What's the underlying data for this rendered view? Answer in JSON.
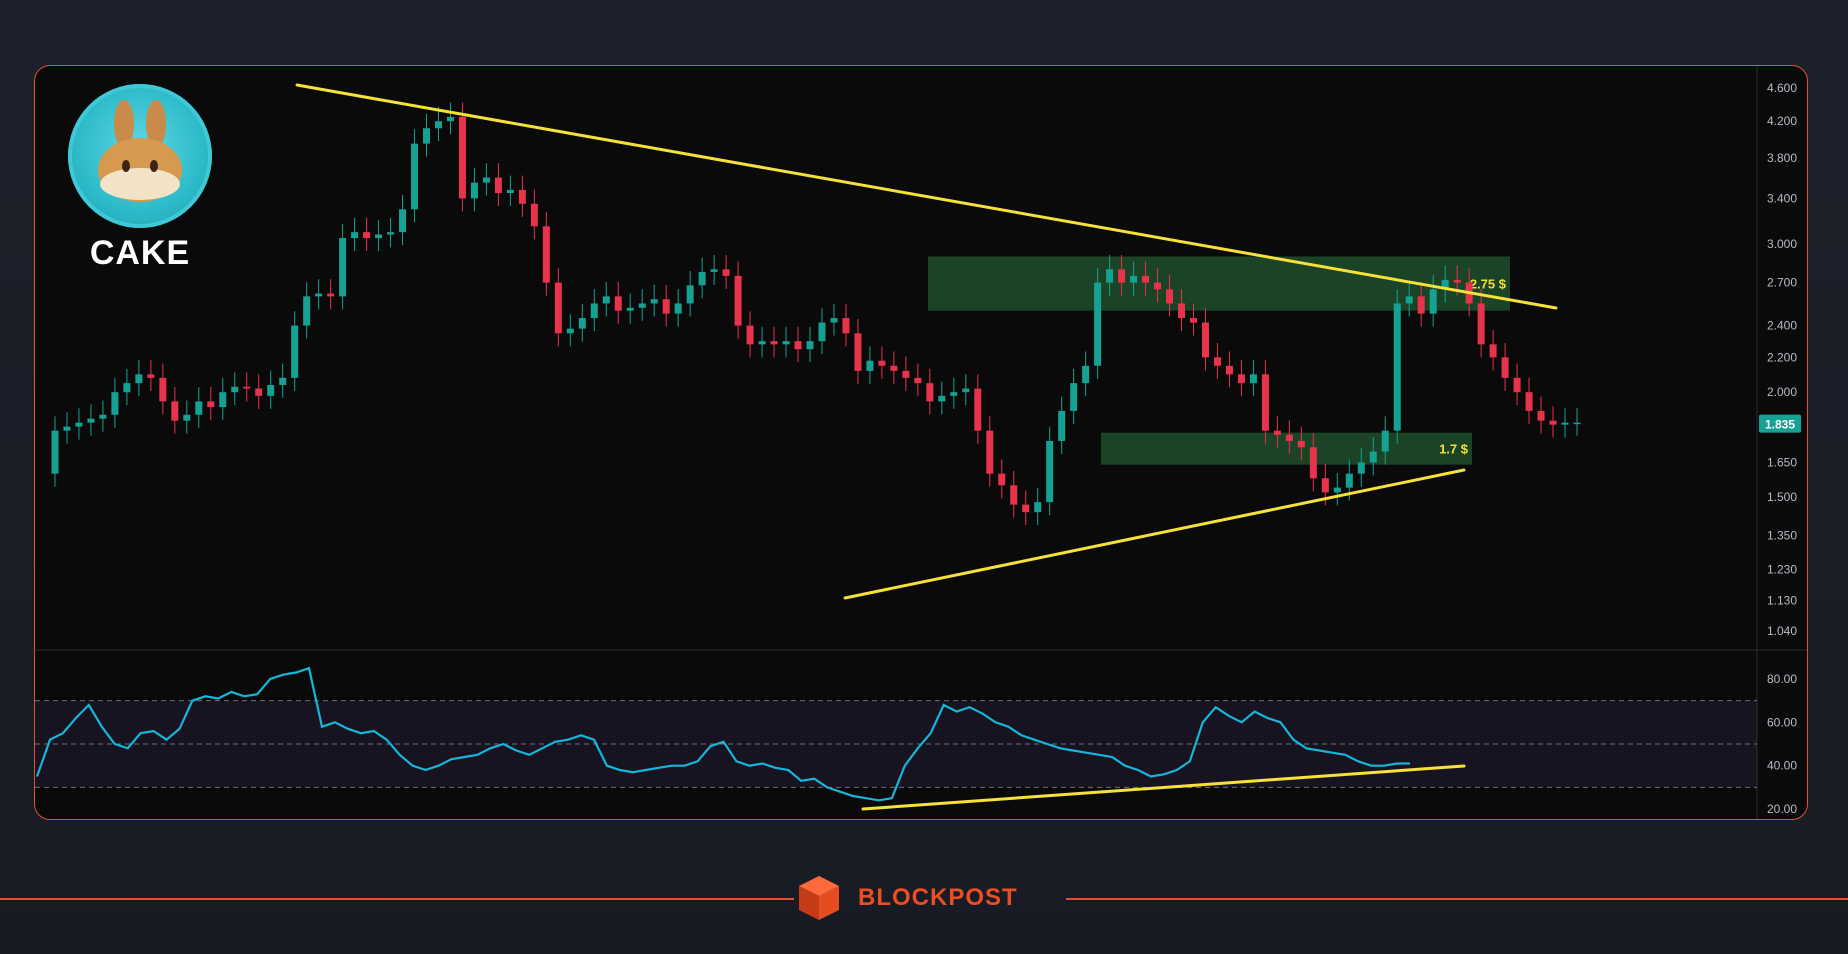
{
  "asset": {
    "name": "CAKE",
    "icon": "pancakeswap-bunny-icon"
  },
  "brand": {
    "name": "BLOCKPOST",
    "icon": "blockpost-cube-icon",
    "accent": "#e0532d"
  },
  "colors": {
    "up": "#16a292",
    "down": "#e8334c",
    "trend": "#f5e13a",
    "zone": "#1f4d2a",
    "rsi": "#16b6d8"
  },
  "chart_data": {
    "type": "candlestick",
    "scale": "log",
    "y_ticks": [
      "4.600",
      "4.200",
      "3.800",
      "3.400",
      "3.000",
      "2.700",
      "2.400",
      "2.200",
      "2.000",
      "1.835",
      "1.650",
      "1.500",
      "1.350",
      "1.230",
      "1.130",
      "1.040"
    ],
    "last_price": "1.835",
    "price": [
      1.6,
      1.8,
      1.82,
      1.84,
      1.86,
      1.88,
      2.0,
      2.05,
      2.1,
      2.08,
      1.95,
      1.85,
      1.88,
      1.95,
      1.92,
      2.0,
      2.03,
      2.02,
      1.98,
      2.04,
      2.08,
      2.4,
      2.6,
      2.62,
      2.6,
      3.05,
      3.1,
      3.05,
      3.08,
      3.1,
      3.3,
      3.95,
      4.12,
      4.2,
      4.25,
      3.4,
      3.55,
      3.6,
      3.45,
      3.48,
      3.35,
      3.15,
      2.7,
      2.35,
      2.38,
      2.45,
      2.55,
      2.6,
      2.5,
      2.52,
      2.55,
      2.58,
      2.48,
      2.55,
      2.68,
      2.78,
      2.8,
      2.75,
      2.4,
      2.28,
      2.3,
      2.28,
      2.3,
      2.25,
      2.3,
      2.42,
      2.45,
      2.35,
      2.12,
      2.18,
      2.15,
      2.12,
      2.08,
      2.05,
      1.95,
      1.98,
      2.0,
      2.02,
      1.8,
      1.6,
      1.55,
      1.47,
      1.44,
      1.48,
      1.75,
      1.9,
      2.05,
      2.15,
      2.7,
      2.8,
      2.7,
      2.75,
      2.7,
      2.65,
      2.55,
      2.45,
      2.42,
      2.2,
      2.15,
      2.1,
      2.05,
      2.1,
      1.8,
      1.78,
      1.75,
      1.72,
      1.58,
      1.52,
      1.54,
      1.6,
      1.65,
      1.7,
      1.8,
      2.55,
      2.6,
      2.48,
      2.65,
      2.72,
      2.7,
      2.55,
      2.28,
      2.2,
      2.08,
      2.0,
      1.9,
      1.85,
      1.83,
      1.84,
      1.84
    ],
    "levels": [
      {
        "label": "2.75 $",
        "low": 2.5,
        "high": 2.9
      },
      {
        "label": "1.7 $",
        "low": 1.64,
        "high": 1.79
      }
    ],
    "rsi_ticks": [
      "80.00",
      "60.00",
      "40.00",
      "20.00"
    ],
    "rsi": [
      35,
      52,
      55,
      62,
      68,
      58,
      50,
      48,
      55,
      56,
      52,
      57,
      70,
      72,
      71,
      74,
      72,
      73,
      80,
      82,
      83,
      85,
      58,
      60,
      57,
      55,
      56,
      52,
      45,
      40,
      38,
      40,
      43,
      44,
      45,
      48,
      50,
      47,
      45,
      48,
      51,
      52,
      54,
      52,
      40,
      38,
      37,
      38,
      39,
      40,
      40,
      42,
      49,
      51,
      42,
      40,
      41,
      39,
      38,
      33,
      34,
      30,
      28,
      26,
      25,
      24,
      25,
      40,
      48,
      55,
      68,
      65,
      67,
      64,
      60,
      58,
      54,
      52,
      50,
      48,
      47,
      46,
      45,
      44,
      40,
      38,
      35,
      36,
      38,
      42,
      60,
      67,
      63,
      60,
      65,
      62,
      60,
      52,
      48,
      47,
      46,
      45,
      42,
      40,
      40,
      41,
      41
    ],
    "rsi_band": [
      30,
      70
    ]
  }
}
